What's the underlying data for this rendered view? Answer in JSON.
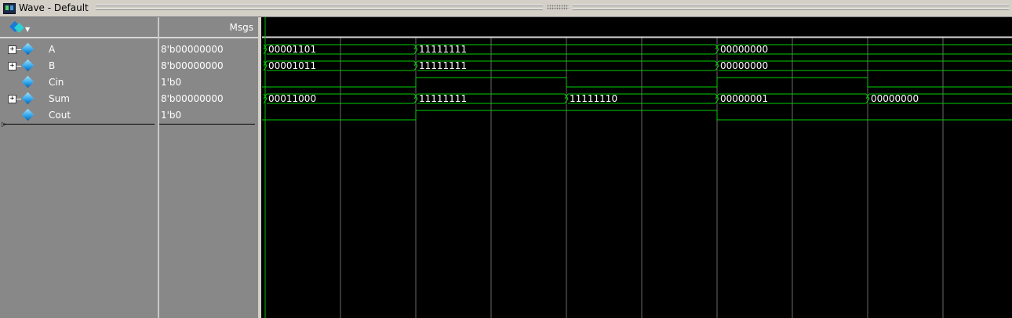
{
  "window": {
    "title": "Wave - Default"
  },
  "columns": {
    "msgs": "Msgs"
  },
  "signals": [
    {
      "name": "A",
      "value": "8'b00000000",
      "expandable": true,
      "kind": "bus"
    },
    {
      "name": "B",
      "value": "8'b00000000",
      "expandable": true,
      "kind": "bus"
    },
    {
      "name": "Cin",
      "value": "1'b0",
      "expandable": false,
      "kind": "bit"
    },
    {
      "name": "Sum",
      "value": "8'b00000000",
      "expandable": true,
      "kind": "bus"
    },
    {
      "name": "Cout",
      "value": "1'b0",
      "expandable": false,
      "kind": "bit"
    }
  ],
  "waveforms": {
    "A": {
      "segments": [
        {
          "start": 0,
          "label": "00001101"
        },
        {
          "start": 2,
          "label": "11111111"
        },
        {
          "start": 6,
          "label": "00000000"
        }
      ]
    },
    "B": {
      "segments": [
        {
          "start": 0,
          "label": "00001011"
        },
        {
          "start": 2,
          "label": "11111111"
        },
        {
          "start": 6,
          "label": "00000000"
        }
      ]
    },
    "Cin": {
      "levels": [
        0,
        0,
        1,
        1,
        0,
        0,
        1,
        1,
        0,
        0
      ]
    },
    "Sum": {
      "segments": [
        {
          "start": 0,
          "label": "00011000"
        },
        {
          "start": 2,
          "label": "11111111"
        },
        {
          "start": 4,
          "label": "11111110"
        },
        {
          "start": 6,
          "label": "00000001"
        },
        {
          "start": 8,
          "label": "00000000"
        }
      ]
    },
    "Cout": {
      "levels": [
        0,
        0,
        1,
        1,
        1,
        1,
        0,
        0,
        0,
        0
      ]
    }
  },
  "colors": {
    "wave": "#00d000",
    "grid": "#6a6a6a",
    "cursor": "#00c000",
    "panel": "#888888"
  }
}
